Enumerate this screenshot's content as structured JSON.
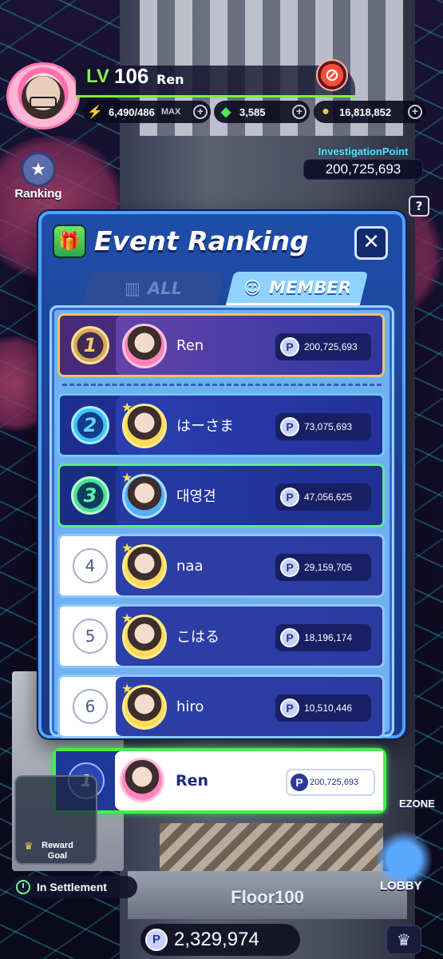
{
  "hud": {
    "level_prefix": "LV",
    "level": "106",
    "player_name": "Ren",
    "energy": "6,490/486",
    "energy_max": "MAX",
    "gems": "3,585",
    "coins": "16,818,852",
    "ranking_label": "Ranking",
    "investigation_title": "InvestigationPoint",
    "investigation_value": "200,725,693",
    "help": "?"
  },
  "modal": {
    "title": "Event Ranking",
    "close": "✕",
    "tabs": [
      {
        "label": "ALL",
        "active": false
      },
      {
        "label": "MEMBER",
        "active": true
      }
    ]
  },
  "rankings": [
    {
      "rank": "1",
      "name": "Ren",
      "score": "200,725,693",
      "tier": "gold"
    },
    {
      "rank": "2",
      "name": "はーさま",
      "score": "73,075,693",
      "tier": "silver"
    },
    {
      "rank": "3",
      "name": "대영견",
      "score": "47,056,625",
      "tier": "bronze"
    },
    {
      "rank": "4",
      "name": "naa",
      "score": "29,159,705",
      "tier": "plain"
    },
    {
      "rank": "5",
      "name": "こはる",
      "score": "18,196,174",
      "tier": "plain"
    },
    {
      "rank": "6",
      "name": "hiro",
      "score": "10,510,446",
      "tier": "plain"
    }
  ],
  "my_rank": {
    "rank": "1",
    "name": "Ren",
    "score": "200,725,693"
  },
  "points_icon": "P",
  "bottom": {
    "reward_line1": "Reward",
    "reward_line2": "Goal",
    "settlement": "In Settlement",
    "floor": "Floor100",
    "total_points": "2,329,974",
    "ezone": "EZONE",
    "lobby": "LOBBY"
  },
  "colors": {
    "accent_green": "#46ee4b",
    "panel_blue": "#1f4ea8",
    "gold": "#f1c36a"
  }
}
